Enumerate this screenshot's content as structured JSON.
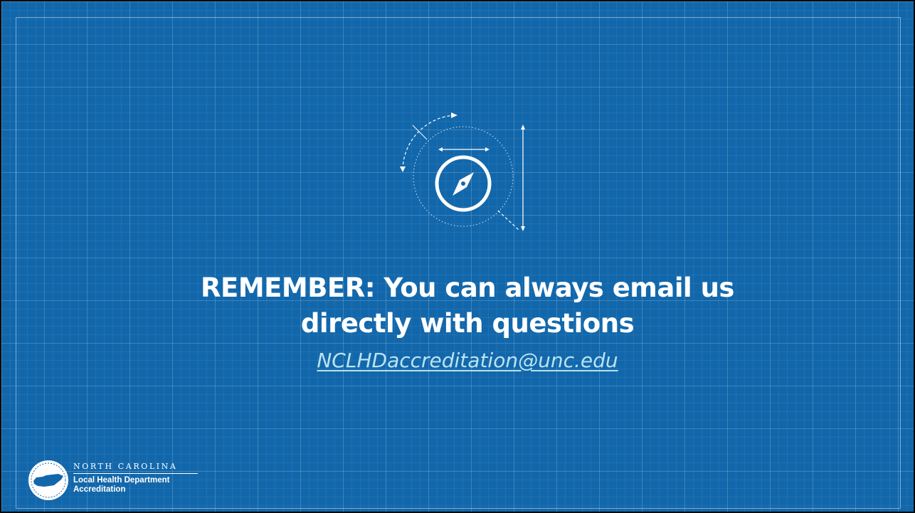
{
  "slide": {
    "headline_line1": "REMEMBER: You can always email us",
    "headline_line2": "directly with questions",
    "email": "NCLHDaccreditation@unc.edu"
  },
  "logo": {
    "state": "NORTH CAROLINA",
    "name_line1": "Local Health Department",
    "name_line2": "Accreditation"
  },
  "icons": {
    "center": "compass-icon",
    "logo_seal": "north-carolina-seal-icon"
  },
  "colors": {
    "background": "#1267ab",
    "headline": "#ffffff",
    "link": "#b9e3f1",
    "frame": "#0a0a0a"
  }
}
